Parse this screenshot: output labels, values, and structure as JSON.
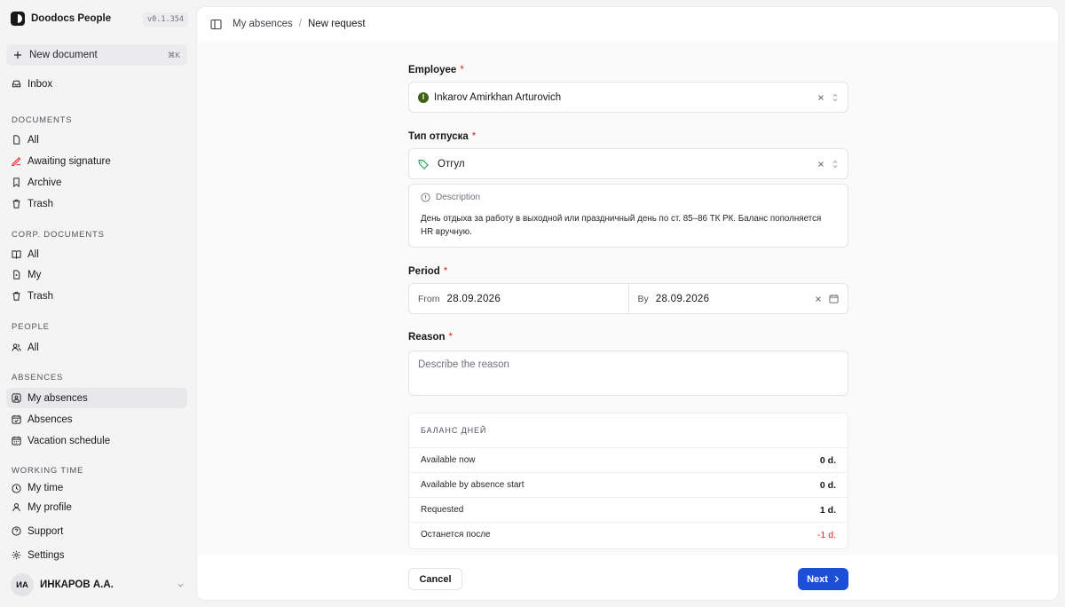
{
  "app": {
    "name": "Doodocs People",
    "version": "v0.1.354"
  },
  "sidebar": {
    "new_document": {
      "label": "New document",
      "shortcut": "⌘K"
    },
    "inbox": "Inbox",
    "documents": {
      "title": "DOCUMENTS",
      "items": [
        "All",
        "Awaiting signature",
        "Archive",
        "Trash"
      ]
    },
    "corp_documents": {
      "title": "CORP. DOCUMENTS",
      "items": [
        "All",
        "My",
        "Trash"
      ]
    },
    "people": {
      "title": "PEOPLE",
      "items": [
        "All"
      ]
    },
    "absences": {
      "title": "ABSENCES",
      "items": [
        "My absences",
        "Absences",
        "Vacation schedule"
      ],
      "active": "My absences"
    },
    "working_time": {
      "title": "WORKING TIME",
      "items": [
        "My time",
        "My profile"
      ]
    },
    "support": "Support",
    "settings": "Settings",
    "user": {
      "initials": "ИА",
      "name": "ИНКАРОВ А.А."
    }
  },
  "breadcrumb": {
    "parent": "My absences",
    "current": "New request"
  },
  "form": {
    "employee": {
      "label": "Employee",
      "value": "Inkarov Amirkhan Arturovich",
      "initial": "I"
    },
    "leave_type": {
      "label": "Тип отпуска",
      "value": "Отгул"
    },
    "description": {
      "label": "Description",
      "text": "День отдыха за работу в выходной или праздничный день по ст. 85–86 ТК РК. Баланс пополняется HR вручную."
    },
    "period": {
      "label": "Period",
      "from_label": "From",
      "from": "28.09.2026",
      "to_label": "By",
      "to": "28.09.2026"
    },
    "reason": {
      "label": "Reason",
      "placeholder": "Describe the reason"
    },
    "required_mark": "*"
  },
  "balance": {
    "title": "БАЛАНС ДНЕЙ",
    "rows": [
      {
        "label": "Available now",
        "value": "0 d."
      },
      {
        "label": "Available by absence start",
        "value": "0 d."
      },
      {
        "label": "Requested",
        "value": "1 d."
      },
      {
        "label": "Останется после",
        "value": "-1 d."
      }
    ]
  },
  "actions": {
    "cancel": "Cancel",
    "next": "Next"
  },
  "colors": {
    "accent": "#1d4ed8",
    "danger": "#dc2626",
    "employee_badge": "#3f6212",
    "tag_icon": "#16a34a",
    "signature_icon": "#dc2626"
  }
}
